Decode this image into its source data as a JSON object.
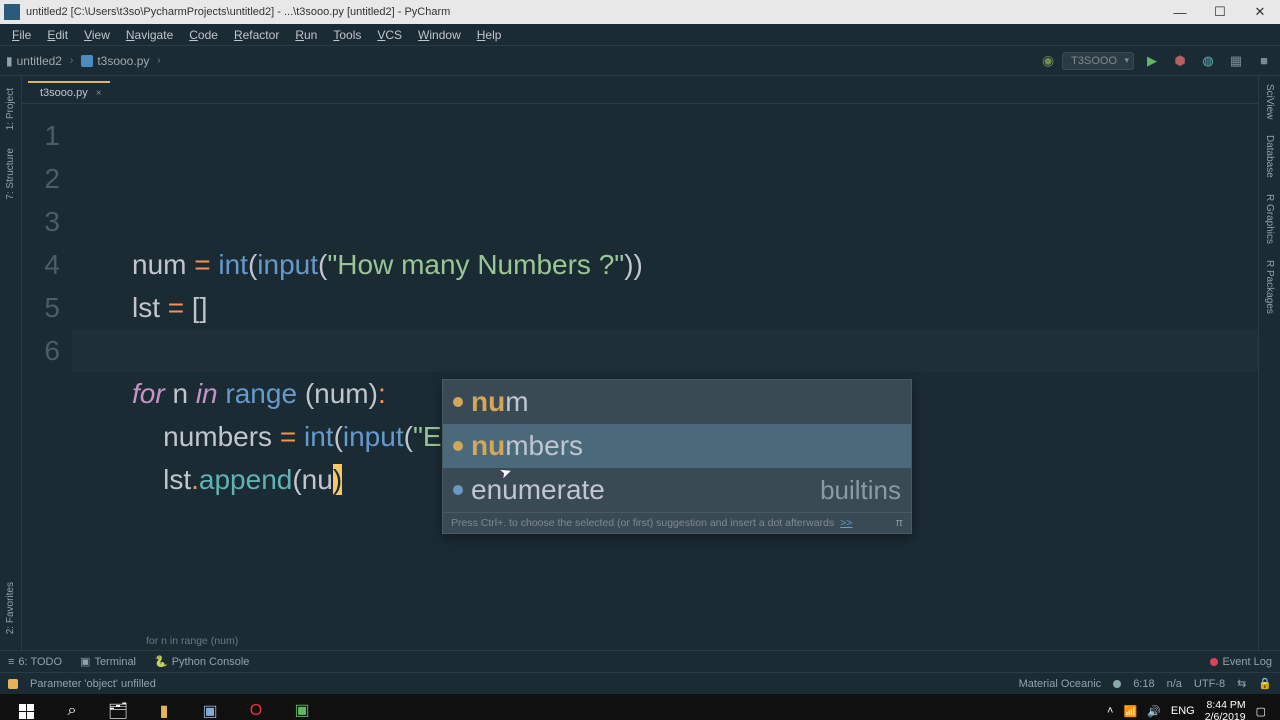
{
  "window": {
    "title": "untitled2 [C:\\Users\\t3so\\PycharmProjects\\untitled2] - ...\\t3sooo.py [untitled2] - PyCharm"
  },
  "menu": [
    "File",
    "Edit",
    "View",
    "Navigate",
    "Code",
    "Refactor",
    "Run",
    "Tools",
    "VCS",
    "Window",
    "Help"
  ],
  "breadcrumbs": {
    "project": "untitled2",
    "file": "t3sooo.py"
  },
  "run_config": {
    "name": "T3SOOO"
  },
  "tab": {
    "name": "t3sooo.py"
  },
  "code": {
    "lines": [
      {
        "n": "1",
        "html": "num <span class='op'>=</span> <span class='builtin'>int</span><span class='paren'>(</span><span class='builtin'>input</span><span class='paren'>(</span><span class='str'>\"How many Numbers ?\"</span><span class='paren'>))</span>"
      },
      {
        "n": "2",
        "html": "lst <span class='op'>=</span> <span class='paren'>[]</span>"
      },
      {
        "n": "3",
        "html": ""
      },
      {
        "n": "4",
        "html": "<span class='kw'>for</span> n <span class='kw'>in</span> <span class='builtin'>range</span> <span class='paren'>(</span>num<span class='paren'>)</span><span class='op'>:</span>"
      },
      {
        "n": "5",
        "html": "    numbers <span class='op'>=</span> <span class='builtin'>int</span><span class='paren'>(</span><span class='builtin'>input</span><span class='paren'>(</span><span class='str'>\"Enter a number: \"</span><span class='paren'>))</span>"
      },
      {
        "n": "6",
        "html": "    lst<span class='op'>.</span><span class='fn'>append</span><span class='paren'>(</span>nu<span class='cursor-hl'>)</span>"
      }
    ]
  },
  "autocomplete": {
    "items": [
      {
        "kind": "v",
        "match": "nu",
        "rest": "m",
        "right": "",
        "selected": false
      },
      {
        "kind": "v",
        "match": "nu",
        "rest": "mbers",
        "right": "",
        "selected": true
      },
      {
        "kind": "f",
        "match": "",
        "label": "enumerate",
        "right": "builtins",
        "selected": false
      }
    ],
    "hint": "Press Ctrl+. to choose the selected (or first) suggestion and insert a dot afterwards",
    "hint_link": ">>",
    "pi": "π"
  },
  "context_crumb": "for n in range (num)",
  "left_tabs": [
    "1: Project"
  ],
  "right_tabs": [
    "SciView",
    "Database",
    "R Graphics",
    "R Packages"
  ],
  "bottom_tabs": {
    "todo": "6: TODO",
    "terminal": "Terminal",
    "console": "Python Console",
    "eventlog": "Event Log"
  },
  "statusbar": {
    "hint": "Parameter 'object' unfilled",
    "theme": "Material Oceanic",
    "pos": "6:18",
    "sep": "n/a",
    "enc": "UTF-8",
    "lock": "🔒"
  },
  "taskbar": {
    "tray": {
      "up": "˄",
      "wifi": "📶",
      "sound": "🔊",
      "lang": "ENG",
      "time": "8:44 PM",
      "date": "2/6/2019",
      "notif": "▢"
    }
  }
}
